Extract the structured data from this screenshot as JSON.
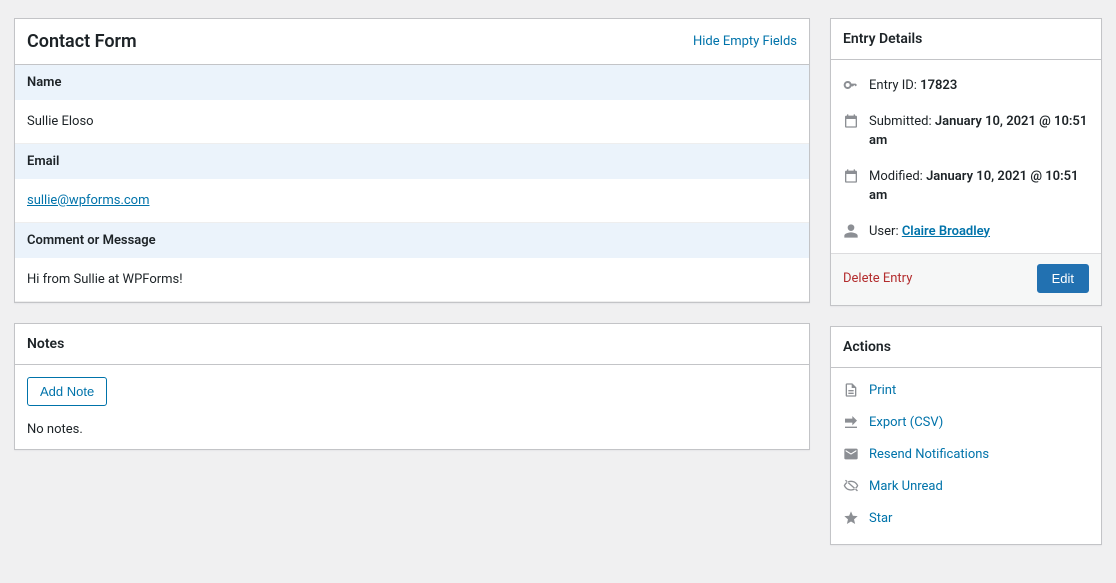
{
  "main": {
    "title": "Contact Form",
    "hide_empty": "Hide Empty Fields",
    "fields": {
      "name_label": "Name",
      "name_value": "Sullie Eloso",
      "email_label": "Email",
      "email_value": "sullie@wpforms.com",
      "comment_label": "Comment or Message",
      "comment_value": "Hi from Sullie at WPForms!"
    }
  },
  "notes": {
    "title": "Notes",
    "add_button": "Add Note",
    "empty_text": "No notes."
  },
  "details": {
    "title": "Entry Details",
    "entry_id_label": "Entry ID: ",
    "entry_id_value": "17823",
    "submitted_label": "Submitted: ",
    "submitted_value": "January 10, 2021 @ 10:51 am",
    "modified_label": "Modified: ",
    "modified_value": "January 10, 2021 @ 10:51 am",
    "user_label": "User: ",
    "user_value": "Claire Broadley",
    "delete": "Delete Entry",
    "edit": "Edit"
  },
  "actions": {
    "title": "Actions",
    "print": "Print",
    "export": "Export (CSV)",
    "resend": "Resend Notifications",
    "mark_unread": "Mark Unread",
    "star": "Star"
  }
}
